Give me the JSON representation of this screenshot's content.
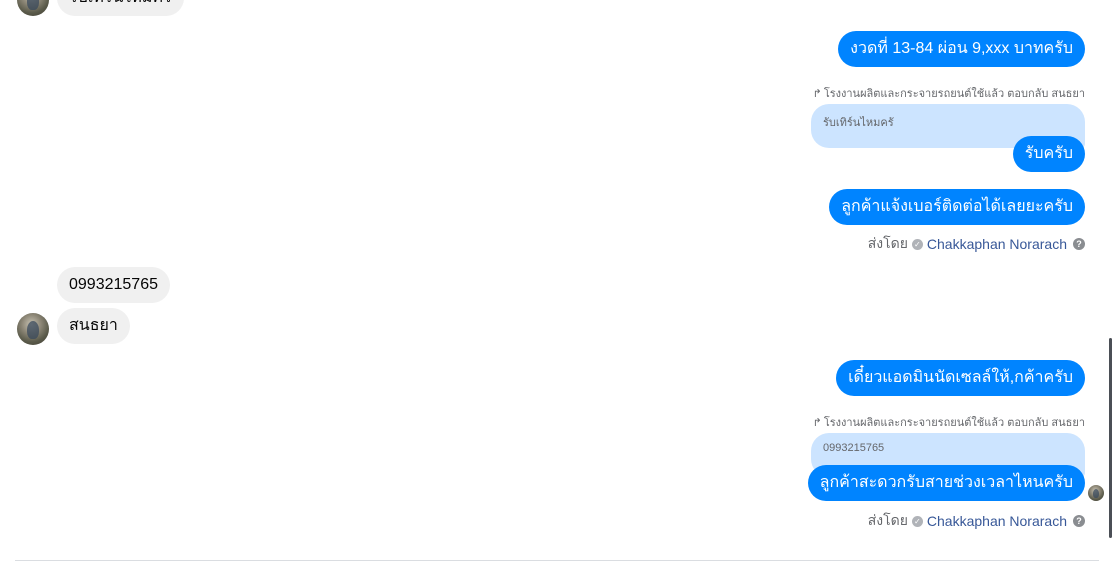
{
  "incoming_top": {
    "text": "รับเทิร์นไหมครั"
  },
  "outgoing_1": {
    "text": "งวดที่ 13-84 ผ่อน 9,xxx บาทครับ"
  },
  "reply_1": {
    "label": "โรงงานผลิตและกระจายรถยนต์ใช้แล้ว ตอบกลับ สนธยา",
    "quoted": "รับเทิร์นไหมครั",
    "text": "รับครับ"
  },
  "outgoing_2": {
    "text": "ลูกค้าแจ้งเบอร์ติดต่อได้เลยยะครับ"
  },
  "sent_by_1": {
    "prefix": "ส่งโดย",
    "name": "Chakkaphan Norarach"
  },
  "incoming_phone": {
    "text": "0993215765"
  },
  "incoming_name": {
    "text": "สนธยา"
  },
  "outgoing_3": {
    "text": "เดี๋ยวแอดมินนัดเซลล์ให้,กค้าครับ"
  },
  "reply_2": {
    "label": "โรงงานผลิตและกระจายรถยนต์ใช้แล้ว ตอบกลับ สนธยา",
    "quoted": "0993215765",
    "text": "ลูกค้าสะดวกรับสายช่วงเวลาไหนครับ"
  },
  "sent_by_2": {
    "prefix": "ส่งโดย",
    "name": "Chakkaphan Norarach"
  },
  "icons": {
    "check": "verified-check-icon",
    "help": "help-circle-icon",
    "reply": "reply-arrow-icon"
  },
  "colors": {
    "outgoing": "#0084ff",
    "incoming": "#f0f0f0",
    "quote": "#cce4ff"
  }
}
